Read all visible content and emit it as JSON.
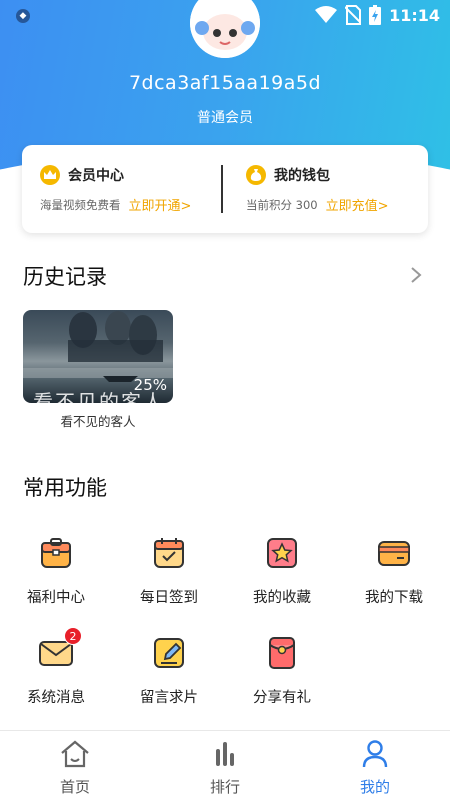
{
  "status_bar": {
    "time": "11:14"
  },
  "profile": {
    "user_id": "7dca3af15aa19a5d",
    "level": "普通会员"
  },
  "card": {
    "member": {
      "title": "会员中心",
      "subtitle": "海量视频免费看",
      "action": "立即开通>"
    },
    "wallet": {
      "title": "我的钱包",
      "subtitle": "当前积分 300",
      "action": "立即充值>"
    }
  },
  "history": {
    "title": "历史记录",
    "items": [
      {
        "title": "看不见的客人",
        "progress": "25%",
        "overlay": "看不见的客人"
      }
    ]
  },
  "functions": {
    "title": "常用功能",
    "items": [
      {
        "label": "福利中心",
        "icon": "gift-box-icon"
      },
      {
        "label": "每日签到",
        "icon": "calendar-check-icon"
      },
      {
        "label": "我的收藏",
        "icon": "star-icon"
      },
      {
        "label": "我的下载",
        "icon": "card-icon"
      },
      {
        "label": "系统消息",
        "icon": "mail-icon",
        "badge": "2"
      },
      {
        "label": "留言求片",
        "icon": "edit-icon"
      },
      {
        "label": "分享有礼",
        "icon": "red-envelope-icon"
      }
    ]
  },
  "bottom_nav": {
    "items": [
      {
        "label": "首页",
        "icon": "home-icon"
      },
      {
        "label": "排行",
        "icon": "ranking-icon"
      },
      {
        "label": "我的",
        "icon": "user-icon",
        "active": true
      }
    ]
  },
  "colors": {
    "accent": "#2f7ee8",
    "gold": "#f0a500",
    "badge": "#e8202a"
  }
}
